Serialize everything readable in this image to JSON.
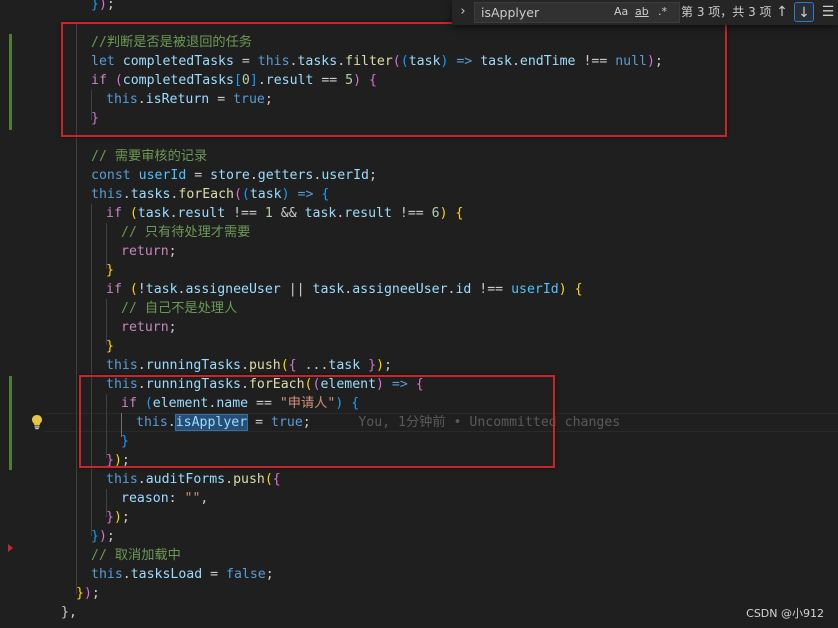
{
  "find_widget": {
    "query": "isApplyer",
    "match_case_label": "Aa",
    "whole_word_label": "ab",
    "regex_label": ".*",
    "result_count": "第 3 项，共 3 项",
    "prev_icon": "arrow-up-icon",
    "next_icon": "arrow-down-icon",
    "menu_icon": "selection-menu-icon"
  },
  "code": {
    "blame_text": "You, 1分钟前 • Uncommitted changes",
    "comments": {
      "return_check": "//判断是否是被退回的任务",
      "audit_records": "// 需要审核的记录",
      "pending_only": "// 只有待处理才需要",
      "not_handler": "// 自己不是处理人",
      "cancel_loading": "// 取消加载中"
    },
    "strings": {
      "applicant": "\"申请人\"",
      "empty": "\"\""
    }
  },
  "watermark": "CSDN @小912",
  "colors": {
    "highlight_box": "#c8262b",
    "modified_gutter": "#4e7d35",
    "find_active_border": "#2b79d0"
  }
}
